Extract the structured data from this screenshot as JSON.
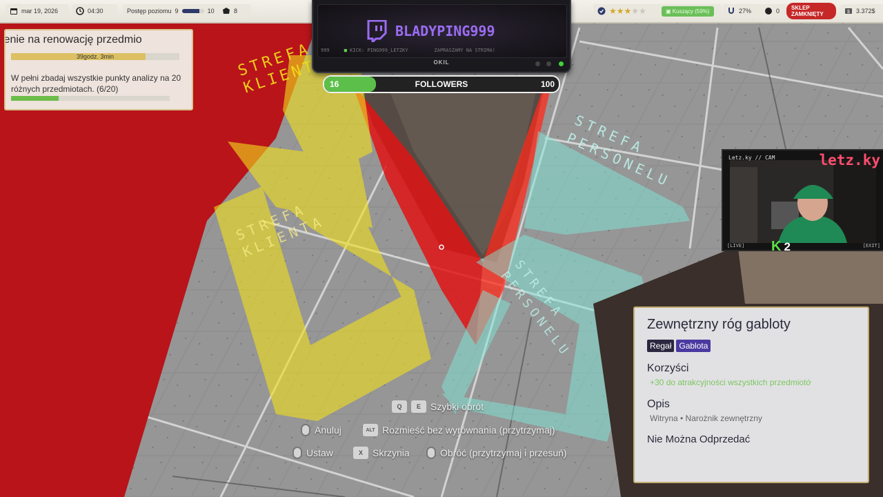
{
  "topbar": {
    "date": "mar 19, 2026",
    "time": "04:30",
    "level_label": "Postęp poziomu",
    "level_current": "9",
    "level_next": "10",
    "level_progress": 0.8,
    "token_count": "8",
    "rating_stars_filled": 3,
    "rating_stars_total": 5,
    "appeal_badge": "Kuszący (59%)",
    "pct_value": "27%",
    "dark_count": "0",
    "shop_status": "SKLEP ZAMKNIĘTY",
    "money": "3.372$"
  },
  "stream_overlay": {
    "channel_name": "BLADYPING999",
    "ticker_prefix": "999",
    "ticker_kick": "KICK: PING999_LETZKY",
    "ticker_message": "ZAPRASZAMY NA STRIMA!",
    "brand": "OKIL",
    "followers_label": "FOLLOWERS",
    "followers_current": "16",
    "followers_goal": "100",
    "followers_fraction": 0.16
  },
  "quest": {
    "title": "lenie na renowację przedmio",
    "timer": "39godz. 3min",
    "timer_progress": 0.8,
    "description": "W pełni zbadaj wszystkie punkty analizy na 20 różnych przedmiotach.  (6/20)",
    "progress_fraction": 0.3
  },
  "webcam": {
    "label": "Letz.ky // CAM",
    "logo": "letz.ky",
    "live_tag": "[LIVE]",
    "exit_tag": "[EXIT]",
    "kick_logo": "K",
    "kick_count": "2"
  },
  "zones": {
    "customer": "STREFA KLIENTA",
    "staff": "STREFA PERSONELU"
  },
  "item_info": {
    "title": "Zewnętrzny róg gabloty",
    "tags": [
      "Regał",
      "Gablota"
    ],
    "benefits_heading": "Korzyści",
    "benefit_text": "+30 do atrakcyjności wszystkich przedmiotów",
    "description_heading": "Opis",
    "description_text": "Witryna • Narożnik zewnętrzny",
    "resale_text": "Nie Można Odprzedać"
  },
  "controls": {
    "rotate_fast": {
      "keys": [
        "Q",
        "E"
      ],
      "label": "Szybki obrót"
    },
    "cancel": {
      "label": "Anuluj"
    },
    "place_free": {
      "key": "ALT",
      "label": "Rozmieść bez wyrównania (przytrzymaj)"
    },
    "place": {
      "label": "Ustaw"
    },
    "crate": {
      "key": "X",
      "label": "Skrzynia"
    },
    "rotate": {
      "label": "Obróć (przytrzymaj i przesuń)"
    }
  },
  "colors": {
    "customer_zone": "#f2e01a",
    "staff_zone": "#7fe8d8",
    "red_wall": "#b8141a",
    "twitch": "#9b6cf2",
    "kick": "#5fe04a",
    "shop_closed": "#c62828"
  }
}
